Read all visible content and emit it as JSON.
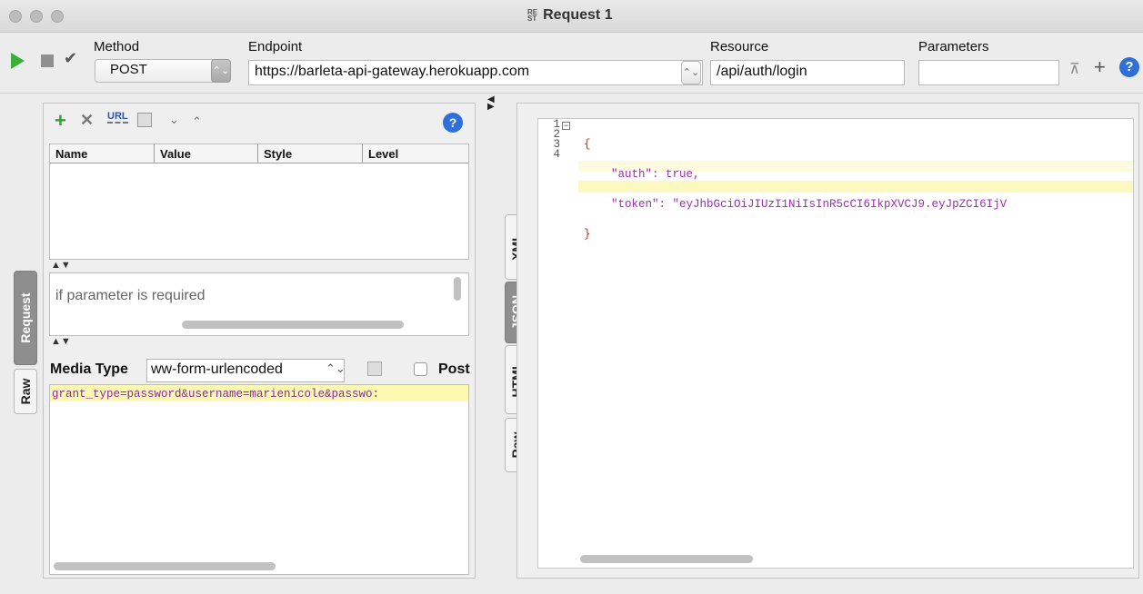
{
  "window": {
    "title": "Request 1",
    "rest_badge_top": "RE",
    "rest_badge_bottom": "ST"
  },
  "toolbar": {
    "method_label": "Method",
    "method_value": "POST",
    "endpoint_label": "Endpoint",
    "endpoint_value": "https://barleta-api-gateway.herokuapp.com",
    "resource_label": "Resource",
    "resource_value": "/api/auth/login",
    "parameters_label": "Parameters",
    "parameters_value": ""
  },
  "left_tabs": [
    "Request",
    "Raw"
  ],
  "params_table": {
    "columns": [
      "Name",
      "Value",
      "Style",
      "Level"
    ],
    "rows": []
  },
  "param_description": "if parameter is required",
  "media": {
    "label": "Media Type",
    "value": "ww-form-urlencoded",
    "post_label": "Post",
    "body": "grant_type=password&username=marienicole&passwo:"
  },
  "response_tabs": [
    "XML",
    "JSON",
    "HTML",
    "Raw"
  ],
  "response": {
    "lines": [
      {
        "num": "1",
        "text": "{"
      },
      {
        "num": "2",
        "text": "    \"auth\": true,"
      },
      {
        "num": "3",
        "text": "    \"token\": \"eyJhbGciOiJIUzI1NiIsInR5cCI6IkpXVCJ9.eyJpZCI6IjV"
      },
      {
        "num": "4",
        "text": "}"
      }
    ],
    "json_key_color": "#9b2fae",
    "json_string_color": "#9b2fae",
    "json_bool_color": "#1a1aa6",
    "highlight_color": "#fbf8c0"
  },
  "colors": {
    "run_green": "#3ab03a",
    "help_blue": "#2e6fd8",
    "add_green": "#2f9e2f",
    "body_highlight": "#fdf9b0"
  }
}
